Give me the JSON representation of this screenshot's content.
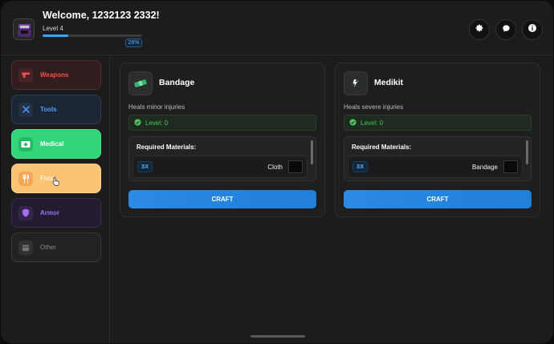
{
  "header": {
    "welcome": "Welcome, 1232123 2332!",
    "level": "Level 4",
    "xp_percent": 26,
    "xp_label": "26%",
    "buttons": [
      "gear-icon",
      "chat-icon",
      "info-icon"
    ]
  },
  "categories": [
    {
      "label": "Weapons",
      "icon": "gun-icon",
      "color": "#ef5350"
    },
    {
      "label": "Tools",
      "icon": "tools-icon",
      "color": "#4f9dff"
    },
    {
      "label": "Medical",
      "icon": "medkit-icon",
      "color": "#33d57c",
      "selected": true
    },
    {
      "label": "Food",
      "icon": "food-icon",
      "color": "#fbc474"
    },
    {
      "label": "Armor",
      "icon": "shield-icon",
      "color": "#a36ef5"
    },
    {
      "label": "Other",
      "icon": "box-icon",
      "color": "#8a8a8a"
    }
  ],
  "recipes": [
    {
      "name": "Bandage",
      "description": "Heals minor injuries",
      "level": "Level: 0",
      "materials_title": "Required Materials:",
      "materials": [
        {
          "qty": "3X",
          "name": "Cloth"
        }
      ],
      "action": "CRAFT"
    },
    {
      "name": "Medikit",
      "description": "Heals severe injuries",
      "level": "Level: 0",
      "materials_title": "Required Materials:",
      "materials": [
        {
          "qty": "3X",
          "name": "Bandage"
        }
      ],
      "action": "CRAFT"
    }
  ],
  "colors": {
    "accent": "#2b8ae3",
    "success": "#4ac65a",
    "background": "#1c1c1c"
  }
}
